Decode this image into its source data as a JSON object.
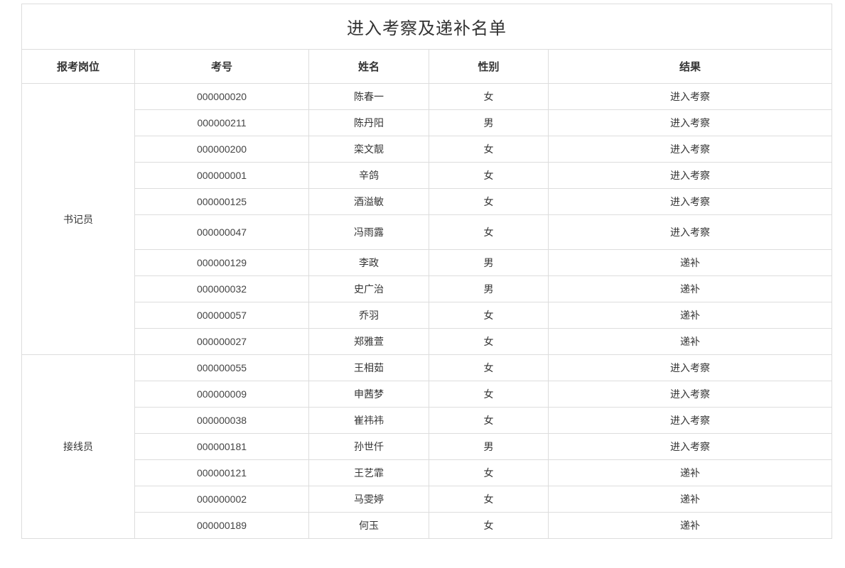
{
  "title": "进入考察及递补名单",
  "headers": [
    "报考岗位",
    "考号",
    "姓名",
    "性别",
    "结果"
  ],
  "groups": [
    {
      "position": "书记员",
      "rows": [
        {
          "exam_number": "000000020",
          "name": "陈春一",
          "gender": "女",
          "result": "进入考察"
        },
        {
          "exam_number": "000000211",
          "name": "陈丹阳",
          "gender": "男",
          "result": "进入考察"
        },
        {
          "exam_number": "000000200",
          "name": "栾文靓",
          "gender": "女",
          "result": "进入考察"
        },
        {
          "exam_number": "000000001",
          "name": "辛鸽",
          "gender": "女",
          "result": "进入考察"
        },
        {
          "exam_number": "000000125",
          "name": "酒溢敏",
          "gender": "女",
          "result": "进入考察"
        },
        {
          "exam_number": "000000047",
          "name": "冯雨露",
          "gender": "女",
          "result": "进入考察"
        },
        {
          "exam_number": "000000129",
          "name": "李政",
          "gender": "男",
          "result": "递补"
        },
        {
          "exam_number": "000000032",
          "name": "史广治",
          "gender": "男",
          "result": "递补"
        },
        {
          "exam_number": "000000057",
          "name": "乔羽",
          "gender": "女",
          "result": "递补"
        },
        {
          "exam_number": "000000027",
          "name": "郑雅萱",
          "gender": "女",
          "result": "递补"
        }
      ]
    },
    {
      "position": "接线员",
      "rows": [
        {
          "exam_number": "000000055",
          "name": "王相茹",
          "gender": "女",
          "result": "进入考察"
        },
        {
          "exam_number": "000000009",
          "name": "申茜梦",
          "gender": "女",
          "result": "进入考察"
        },
        {
          "exam_number": "000000038",
          "name": "崔祎祎",
          "gender": "女",
          "result": "进入考察"
        },
        {
          "exam_number": "000000181",
          "name": "孙世仟",
          "gender": "男",
          "result": "进入考察"
        },
        {
          "exam_number": "000000121",
          "name": "王艺霏",
          "gender": "女",
          "result": "递补"
        },
        {
          "exam_number": "000000002",
          "name": "马雯婷",
          "gender": "女",
          "result": "递补"
        },
        {
          "exam_number": "000000189",
          "name": "何玉",
          "gender": "女",
          "result": "递补"
        }
      ]
    }
  ]
}
